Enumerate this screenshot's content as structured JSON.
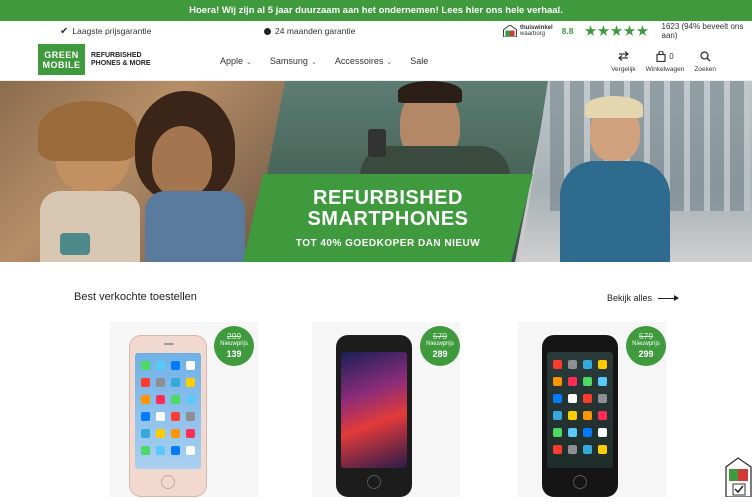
{
  "topbar": {
    "message": "Hoera! Wij zijn al 5 jaar duurzaam aan het ondernemen! Lees hier ons hele verhaal."
  },
  "usp": {
    "item1": "Laagste prijsgarantie",
    "item2": "24 maanden garantie",
    "thuiswinkel_line1": "thuiswinkel",
    "thuiswinkel_line2": "waarborg",
    "score": "8.8",
    "stars": 5,
    "reviews": "1623 (94% beveelt ons aan)"
  },
  "header": {
    "logo_line1": "GREEN",
    "logo_line2": "MOBILE",
    "logo_sub1": "REFURBISHED",
    "logo_sub2": "PHONES & MORE",
    "nav": [
      "Apple",
      "Samsung",
      "Accessoires",
      "Sale"
    ],
    "compare_label": "Vergelijk",
    "cart_label": "Winkelwagen",
    "cart_count": "0",
    "search_label": "Zoeken"
  },
  "hero": {
    "title_line1": "REFURBISHED",
    "title_line2": "SMARTPHONES",
    "subtitle": "TOT 40% GOEDKOPER DAN NIEUW"
  },
  "products_section": {
    "title": "Best verkochte toestellen",
    "see_all": "Bekijk alles",
    "products": [
      {
        "old_price": "299",
        "label": "Nieuwprijs",
        "price": "139"
      },
      {
        "old_price": "579",
        "label": "Nieuwprijs",
        "price": "289"
      },
      {
        "old_price": "579",
        "label": "Nieuwprijs",
        "price": "299"
      }
    ]
  },
  "colors": {
    "brand_green": "#3f9a3d"
  }
}
